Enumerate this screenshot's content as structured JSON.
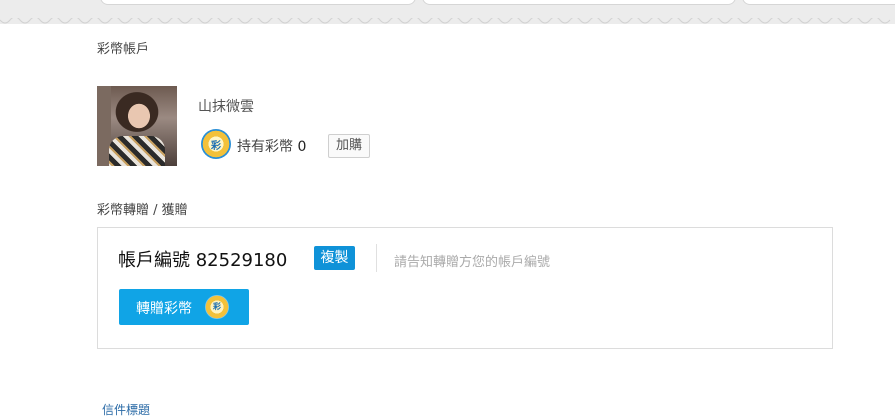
{
  "account": {
    "section_title": "彩幣帳戶",
    "username": "山抹微雲",
    "coin_label": "持有彩幣",
    "coin_count": "0",
    "buy_label": "加購"
  },
  "transfer": {
    "section_title": "彩幣轉贈 / 獲贈",
    "account_number_label": "帳戶編號 82529180",
    "copy_label": "複製",
    "hint": "請告知轉贈方您的帳戶編號",
    "transfer_button_label": "轉贈彩幣"
  },
  "footer": {
    "mail_title_link": "信件標題"
  },
  "icons": {
    "coin_icon": "caibi-coin-icon",
    "coin_glyph": "彩"
  },
  "colors": {
    "primary_blue": "#10a4e6",
    "copy_blue": "#0f92d8",
    "link_blue": "#2a6aa6"
  }
}
